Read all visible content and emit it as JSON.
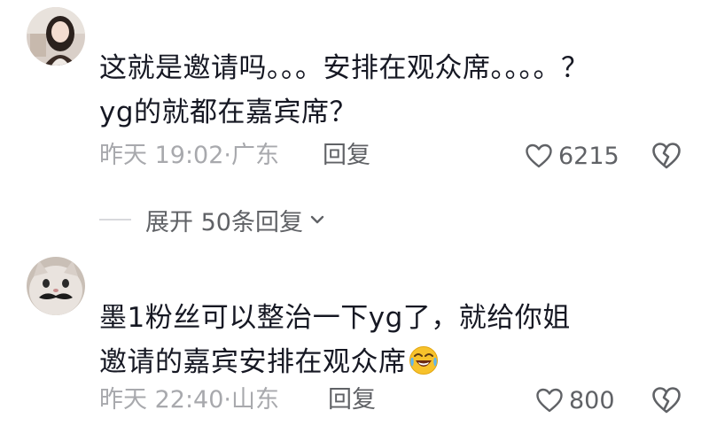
{
  "comments": [
    {
      "avatar": "user-avatar-woman-photo",
      "text": "这就是邀请吗。。。安排在观众席。。。。？yg的就都在嘉宾席？",
      "time_location": "昨天 19:02·广东",
      "reply_label": "回复",
      "like_count": "6215",
      "like_icon": "heart-outline-icon",
      "dislike_icon": "broken-heart-icon"
    },
    {
      "avatar": "user-avatar-cat-mustache",
      "text": "墨1粉丝可以整治一下yg了，就给你姐邀请的嘉宾安排在观众席",
      "emoji": "rolling-laughing-emoji",
      "time_location": "昨天 22:40·山东",
      "reply_label": "回复",
      "like_count": "800",
      "like_icon": "heart-outline-icon",
      "dislike_icon": "broken-heart-icon"
    }
  ],
  "expand_replies": {
    "label": "展开 50条回复",
    "icon": "chevron-down-icon"
  },
  "colors": {
    "text_primary": "#161823",
    "text_secondary": "#a8a9ad",
    "text_action": "#606266",
    "divider": "#d8d9dc",
    "background": "#ffffff"
  }
}
